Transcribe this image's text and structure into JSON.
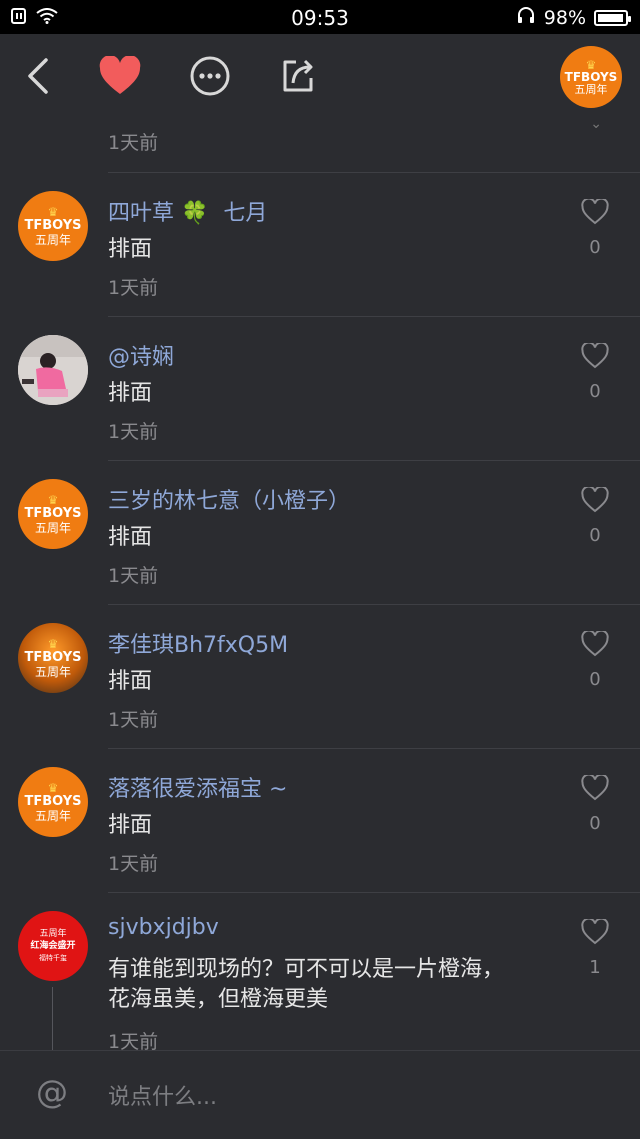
{
  "status_bar": {
    "time": "09:53",
    "battery": "98%",
    "battery_level": 0.98
  },
  "toolbar": {
    "icons": [
      "back-icon",
      "heart-icon",
      "more-icon",
      "share-icon"
    ],
    "avatar": {
      "line1": "TFBOYS",
      "line2": "五周年"
    }
  },
  "partial_item": {
    "time": "1天前"
  },
  "comments": [
    {
      "name_main": "四叶草",
      "name_emoji": "🍀",
      "name_rest": "七月",
      "text": "排面",
      "time": "1天前",
      "likes": "0",
      "avatar": {
        "type": "tfboys",
        "line1": "TFBOYS",
        "line2": "五周年"
      }
    },
    {
      "name_main": "@诗娴",
      "text": "排面",
      "time": "1天前",
      "likes": "0",
      "avatar": {
        "type": "photo"
      }
    },
    {
      "name_main": "三岁的林七意（小橙子）",
      "text": "排面",
      "time": "1天前",
      "likes": "0",
      "avatar": {
        "type": "tfboys",
        "line1": "TFBOYS",
        "line2": "五周年"
      }
    },
    {
      "name_main": "李佳琪Bh7fxQ5M",
      "text": "排面",
      "time": "1天前",
      "likes": "0",
      "avatar": {
        "type": "tfboys-dark",
        "line1": "TFBOYS",
        "line2": "五周年"
      }
    },
    {
      "name_main": "落落很爱添福宝 ~",
      "text": "排面",
      "time": "1天前",
      "likes": "0",
      "avatar": {
        "type": "tfboys",
        "line1": "TFBOYS",
        "line2": "五周年"
      }
    },
    {
      "name_main": "sjvbxjdjbv",
      "text": "有谁能到现场的？可不可以是一片橙海，花海虽美，但橙海更美",
      "time": "1天前",
      "likes": "1",
      "avatar": {
        "type": "red",
        "line1": "五周年",
        "line2": "红海会盛开",
        "line3": "福特千玺"
      }
    }
  ],
  "input": {
    "placeholder": "说点什么..."
  },
  "colors": {
    "background": "#2b2c30",
    "name": "#8fa8d8",
    "accent": "#f07c12",
    "heart": "#f25c5c"
  }
}
